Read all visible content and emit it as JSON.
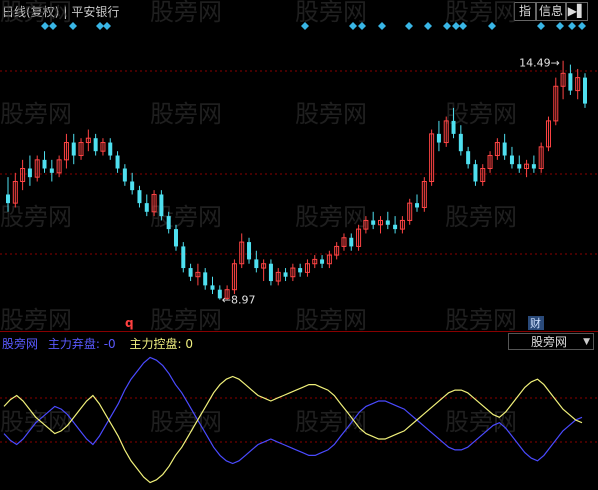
{
  "header": {
    "period_label": "日线(复权)",
    "stock_name": "平安银行",
    "btn_zhi": "指",
    "btn_info": "信息",
    "btn_arrow": "▶▌"
  },
  "watermark": "股旁网",
  "colors": {
    "up": "#ff4444",
    "down": "#4fe0f0",
    "grid": "#8a0000",
    "diamond": "#39b6e6",
    "series_blue": "#4a4aff",
    "series_yellow": "#f0f07a"
  },
  "chart_data": [
    {
      "type": "candlestick",
      "annotations": {
        "high_label": "14.49",
        "low_label": "8.97",
        "q_marker": "q",
        "cai_marker": "财"
      },
      "diamond_x_positions_pct": [],
      "candles": [
        {
          "o": 11.4,
          "h": 11.8,
          "l": 11.0,
          "c": 11.2
        },
        {
          "o": 11.2,
          "h": 11.9,
          "l": 11.1,
          "c": 11.7
        },
        {
          "o": 11.7,
          "h": 12.2,
          "l": 11.5,
          "c": 12.0
        },
        {
          "o": 12.0,
          "h": 12.3,
          "l": 11.6,
          "c": 11.8
        },
        {
          "o": 11.8,
          "h": 12.3,
          "l": 11.7,
          "c": 12.2
        },
        {
          "o": 12.2,
          "h": 12.4,
          "l": 11.9,
          "c": 12.0
        },
        {
          "o": 12.0,
          "h": 12.2,
          "l": 11.7,
          "c": 11.9
        },
        {
          "o": 11.9,
          "h": 12.3,
          "l": 11.8,
          "c": 12.2
        },
        {
          "o": 12.2,
          "h": 12.8,
          "l": 12.0,
          "c": 12.6
        },
        {
          "o": 12.6,
          "h": 12.8,
          "l": 12.1,
          "c": 12.3
        },
        {
          "o": 12.3,
          "h": 12.7,
          "l": 12.2,
          "c": 12.6
        },
        {
          "o": 12.6,
          "h": 12.9,
          "l": 12.4,
          "c": 12.7
        },
        {
          "o": 12.7,
          "h": 12.8,
          "l": 12.3,
          "c": 12.4
        },
        {
          "o": 12.4,
          "h": 12.7,
          "l": 12.3,
          "c": 12.6
        },
        {
          "o": 12.6,
          "h": 12.7,
          "l": 12.2,
          "c": 12.3
        },
        {
          "o": 12.3,
          "h": 12.4,
          "l": 11.9,
          "c": 12.0
        },
        {
          "o": 12.0,
          "h": 12.1,
          "l": 11.6,
          "c": 11.7
        },
        {
          "o": 11.7,
          "h": 11.9,
          "l": 11.4,
          "c": 11.5
        },
        {
          "o": 11.5,
          "h": 11.6,
          "l": 11.1,
          "c": 11.2
        },
        {
          "o": 11.2,
          "h": 11.4,
          "l": 10.9,
          "c": 11.0
        },
        {
          "o": 11.0,
          "h": 11.5,
          "l": 10.9,
          "c": 11.4
        },
        {
          "o": 11.4,
          "h": 11.5,
          "l": 10.8,
          "c": 10.9
        },
        {
          "o": 10.9,
          "h": 11.0,
          "l": 10.5,
          "c": 10.6
        },
        {
          "o": 10.6,
          "h": 10.7,
          "l": 10.1,
          "c": 10.2
        },
        {
          "o": 10.2,
          "h": 10.3,
          "l": 9.6,
          "c": 9.7
        },
        {
          "o": 9.7,
          "h": 9.8,
          "l": 9.4,
          "c": 9.5
        },
        {
          "o": 9.5,
          "h": 9.8,
          "l": 9.3,
          "c": 9.6
        },
        {
          "o": 9.6,
          "h": 9.7,
          "l": 9.2,
          "c": 9.3
        },
        {
          "o": 9.3,
          "h": 9.5,
          "l": 9.1,
          "c": 9.2
        },
        {
          "o": 9.2,
          "h": 9.3,
          "l": 8.97,
          "c": 9.0
        },
        {
          "o": 9.0,
          "h": 9.3,
          "l": 8.97,
          "c": 9.2
        },
        {
          "o": 9.2,
          "h": 9.9,
          "l": 9.1,
          "c": 9.8
        },
        {
          "o": 9.8,
          "h": 10.5,
          "l": 9.7,
          "c": 10.3
        },
        {
          "o": 10.3,
          "h": 10.4,
          "l": 9.8,
          "c": 9.9
        },
        {
          "o": 9.9,
          "h": 10.1,
          "l": 9.6,
          "c": 9.7
        },
        {
          "o": 9.7,
          "h": 9.9,
          "l": 9.4,
          "c": 9.8
        },
        {
          "o": 9.8,
          "h": 9.9,
          "l": 9.3,
          "c": 9.4
        },
        {
          "o": 9.4,
          "h": 9.7,
          "l": 9.3,
          "c": 9.6
        },
        {
          "o": 9.6,
          "h": 9.7,
          "l": 9.4,
          "c": 9.5
        },
        {
          "o": 9.5,
          "h": 9.8,
          "l": 9.4,
          "c": 9.7
        },
        {
          "o": 9.7,
          "h": 9.8,
          "l": 9.5,
          "c": 9.6
        },
        {
          "o": 9.6,
          "h": 9.9,
          "l": 9.5,
          "c": 9.8
        },
        {
          "o": 9.8,
          "h": 10.0,
          "l": 9.7,
          "c": 9.9
        },
        {
          "o": 9.9,
          "h": 10.0,
          "l": 9.7,
          "c": 9.8
        },
        {
          "o": 9.8,
          "h": 10.1,
          "l": 9.7,
          "c": 10.0
        },
        {
          "o": 10.0,
          "h": 10.3,
          "l": 9.9,
          "c": 10.2
        },
        {
          "o": 10.2,
          "h": 10.5,
          "l": 10.1,
          "c": 10.4
        },
        {
          "o": 10.4,
          "h": 10.5,
          "l": 10.1,
          "c": 10.2
        },
        {
          "o": 10.2,
          "h": 10.7,
          "l": 10.1,
          "c": 10.6
        },
        {
          "o": 10.6,
          "h": 10.9,
          "l": 10.5,
          "c": 10.8
        },
        {
          "o": 10.8,
          "h": 11.0,
          "l": 10.6,
          "c": 10.7
        },
        {
          "o": 10.7,
          "h": 10.9,
          "l": 10.5,
          "c": 10.8
        },
        {
          "o": 10.8,
          "h": 11.0,
          "l": 10.6,
          "c": 10.7
        },
        {
          "o": 10.7,
          "h": 10.9,
          "l": 10.5,
          "c": 10.6
        },
        {
          "o": 10.6,
          "h": 10.9,
          "l": 10.5,
          "c": 10.8
        },
        {
          "o": 10.8,
          "h": 11.3,
          "l": 10.7,
          "c": 11.2
        },
        {
          "o": 11.2,
          "h": 11.4,
          "l": 11.0,
          "c": 11.1
        },
        {
          "o": 11.1,
          "h": 11.8,
          "l": 11.0,
          "c": 11.7
        },
        {
          "o": 11.7,
          "h": 12.9,
          "l": 11.6,
          "c": 12.8
        },
        {
          "o": 12.8,
          "h": 13.1,
          "l": 12.4,
          "c": 12.6
        },
        {
          "o": 12.6,
          "h": 13.2,
          "l": 12.5,
          "c": 13.1
        },
        {
          "o": 13.1,
          "h": 13.4,
          "l": 12.7,
          "c": 12.8
        },
        {
          "o": 12.8,
          "h": 13.0,
          "l": 12.3,
          "c": 12.4
        },
        {
          "o": 12.4,
          "h": 12.5,
          "l": 12.0,
          "c": 12.1
        },
        {
          "o": 12.1,
          "h": 12.2,
          "l": 11.6,
          "c": 11.7
        },
        {
          "o": 11.7,
          "h": 12.1,
          "l": 11.6,
          "c": 12.0
        },
        {
          "o": 12.0,
          "h": 12.4,
          "l": 11.9,
          "c": 12.3
        },
        {
          "o": 12.3,
          "h": 12.7,
          "l": 12.2,
          "c": 12.6
        },
        {
          "o": 12.6,
          "h": 12.8,
          "l": 12.2,
          "c": 12.3
        },
        {
          "o": 12.3,
          "h": 12.5,
          "l": 12.0,
          "c": 12.1
        },
        {
          "o": 12.1,
          "h": 12.3,
          "l": 11.9,
          "c": 12.0
        },
        {
          "o": 12.0,
          "h": 12.2,
          "l": 11.8,
          "c": 12.1
        },
        {
          "o": 12.1,
          "h": 12.3,
          "l": 11.9,
          "c": 12.0
        },
        {
          "o": 12.0,
          "h": 12.6,
          "l": 11.9,
          "c": 12.5
        },
        {
          "o": 12.5,
          "h": 13.2,
          "l": 12.4,
          "c": 13.1
        },
        {
          "o": 13.1,
          "h": 14.1,
          "l": 13.0,
          "c": 13.9
        },
        {
          "o": 13.9,
          "h": 14.49,
          "l": 13.6,
          "c": 14.2
        },
        {
          "o": 14.2,
          "h": 14.4,
          "l": 13.7,
          "c": 13.8
        },
        {
          "o": 13.8,
          "h": 14.3,
          "l": 13.6,
          "c": 14.1
        },
        {
          "o": 14.1,
          "h": 14.2,
          "l": 13.4,
          "c": 13.5
        }
      ]
    },
    {
      "type": "line",
      "legend": {
        "name": "股旁网",
        "series1_label": "主力弃盘: -0",
        "series2_label": "主力控盘: 0"
      },
      "dropdown_label": "股旁网",
      "series": [
        {
          "name": "主力弃盘",
          "values": [
            -10,
            -15,
            -18,
            -14,
            -8,
            -2,
            2,
            6,
            10,
            8,
            4,
            -2,
            -8,
            -14,
            -18,
            -12,
            -4,
            4,
            12,
            22,
            30,
            36,
            42,
            46,
            44,
            40,
            34,
            26,
            20,
            12,
            4,
            -4,
            -12,
            -20,
            -26,
            -30,
            -32,
            -30,
            -26,
            -22,
            -18,
            -16,
            -14,
            -16,
            -18,
            -20,
            -22,
            -24,
            -26,
            -26,
            -24,
            -22,
            -18,
            -12,
            -6,
            0,
            6,
            10,
            12,
            14,
            14,
            12,
            10,
            8,
            4,
            0,
            -4,
            -8,
            -12,
            -16,
            -20,
            -22,
            -22,
            -20,
            -16,
            -12,
            -8,
            -4,
            -2,
            -6,
            -12,
            -18,
            -24,
            -28,
            -30,
            -26,
            -20,
            -14,
            -8,
            -4,
            0,
            2
          ]
        },
        {
          "name": "主力控盘",
          "values": [
            10,
            15,
            18,
            14,
            8,
            2,
            -2,
            -6,
            -10,
            -8,
            -4,
            2,
            8,
            14,
            18,
            12,
            4,
            -4,
            -12,
            -22,
            -30,
            -36,
            -42,
            -46,
            -44,
            -40,
            -34,
            -26,
            -20,
            -12,
            -4,
            4,
            12,
            20,
            26,
            30,
            32,
            30,
            26,
            22,
            18,
            16,
            14,
            16,
            18,
            20,
            22,
            24,
            26,
            26,
            24,
            22,
            18,
            12,
            6,
            0,
            -6,
            -10,
            -12,
            -14,
            -14,
            -12,
            -10,
            -8,
            -4,
            0,
            4,
            8,
            12,
            16,
            20,
            22,
            22,
            20,
            16,
            12,
            8,
            4,
            2,
            6,
            12,
            18,
            24,
            28,
            30,
            26,
            20,
            14,
            8,
            4,
            0,
            -2
          ]
        }
      ]
    }
  ]
}
